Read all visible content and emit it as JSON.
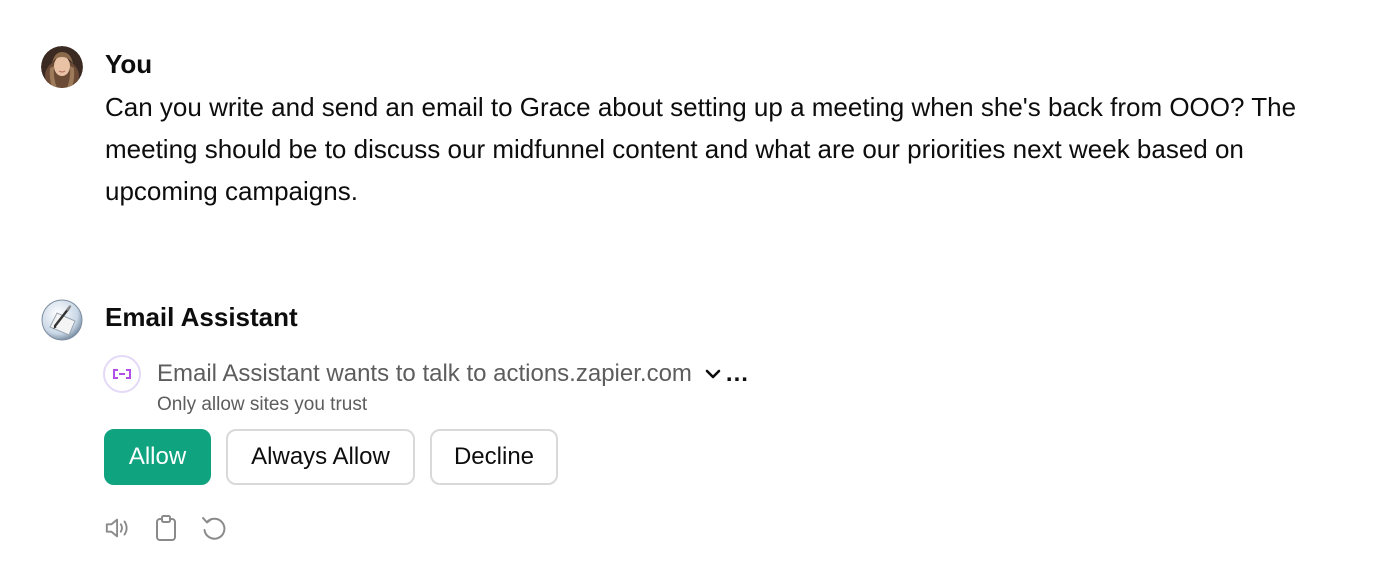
{
  "user_message": {
    "author": "You",
    "avatar_icon": "user-photo-avatar",
    "text": "Can you write and send an email to Grace about setting up a meeting when she's back from OOO? The meeting should be to discuss our midfunnel content and what are our priorities next week based on upcoming campaigns."
  },
  "assistant_message": {
    "author": "Email Assistant",
    "avatar_icon": "pen-and-paper-icon",
    "plugin_request": {
      "icon": "link-icon",
      "text": "Email Assistant wants to talk to actions.zapier.com",
      "more": "...",
      "subtext": "Only allow sites you trust"
    },
    "buttons": {
      "allow": "Allow",
      "always_allow": "Always Allow",
      "decline": "Decline"
    },
    "actions": [
      "speaker-icon",
      "clipboard-icon",
      "regenerate-icon"
    ]
  },
  "colors": {
    "accent_green": "#10a37f",
    "link_icon_purple": "#b14fe8",
    "muted_text": "#5d5d5d"
  }
}
